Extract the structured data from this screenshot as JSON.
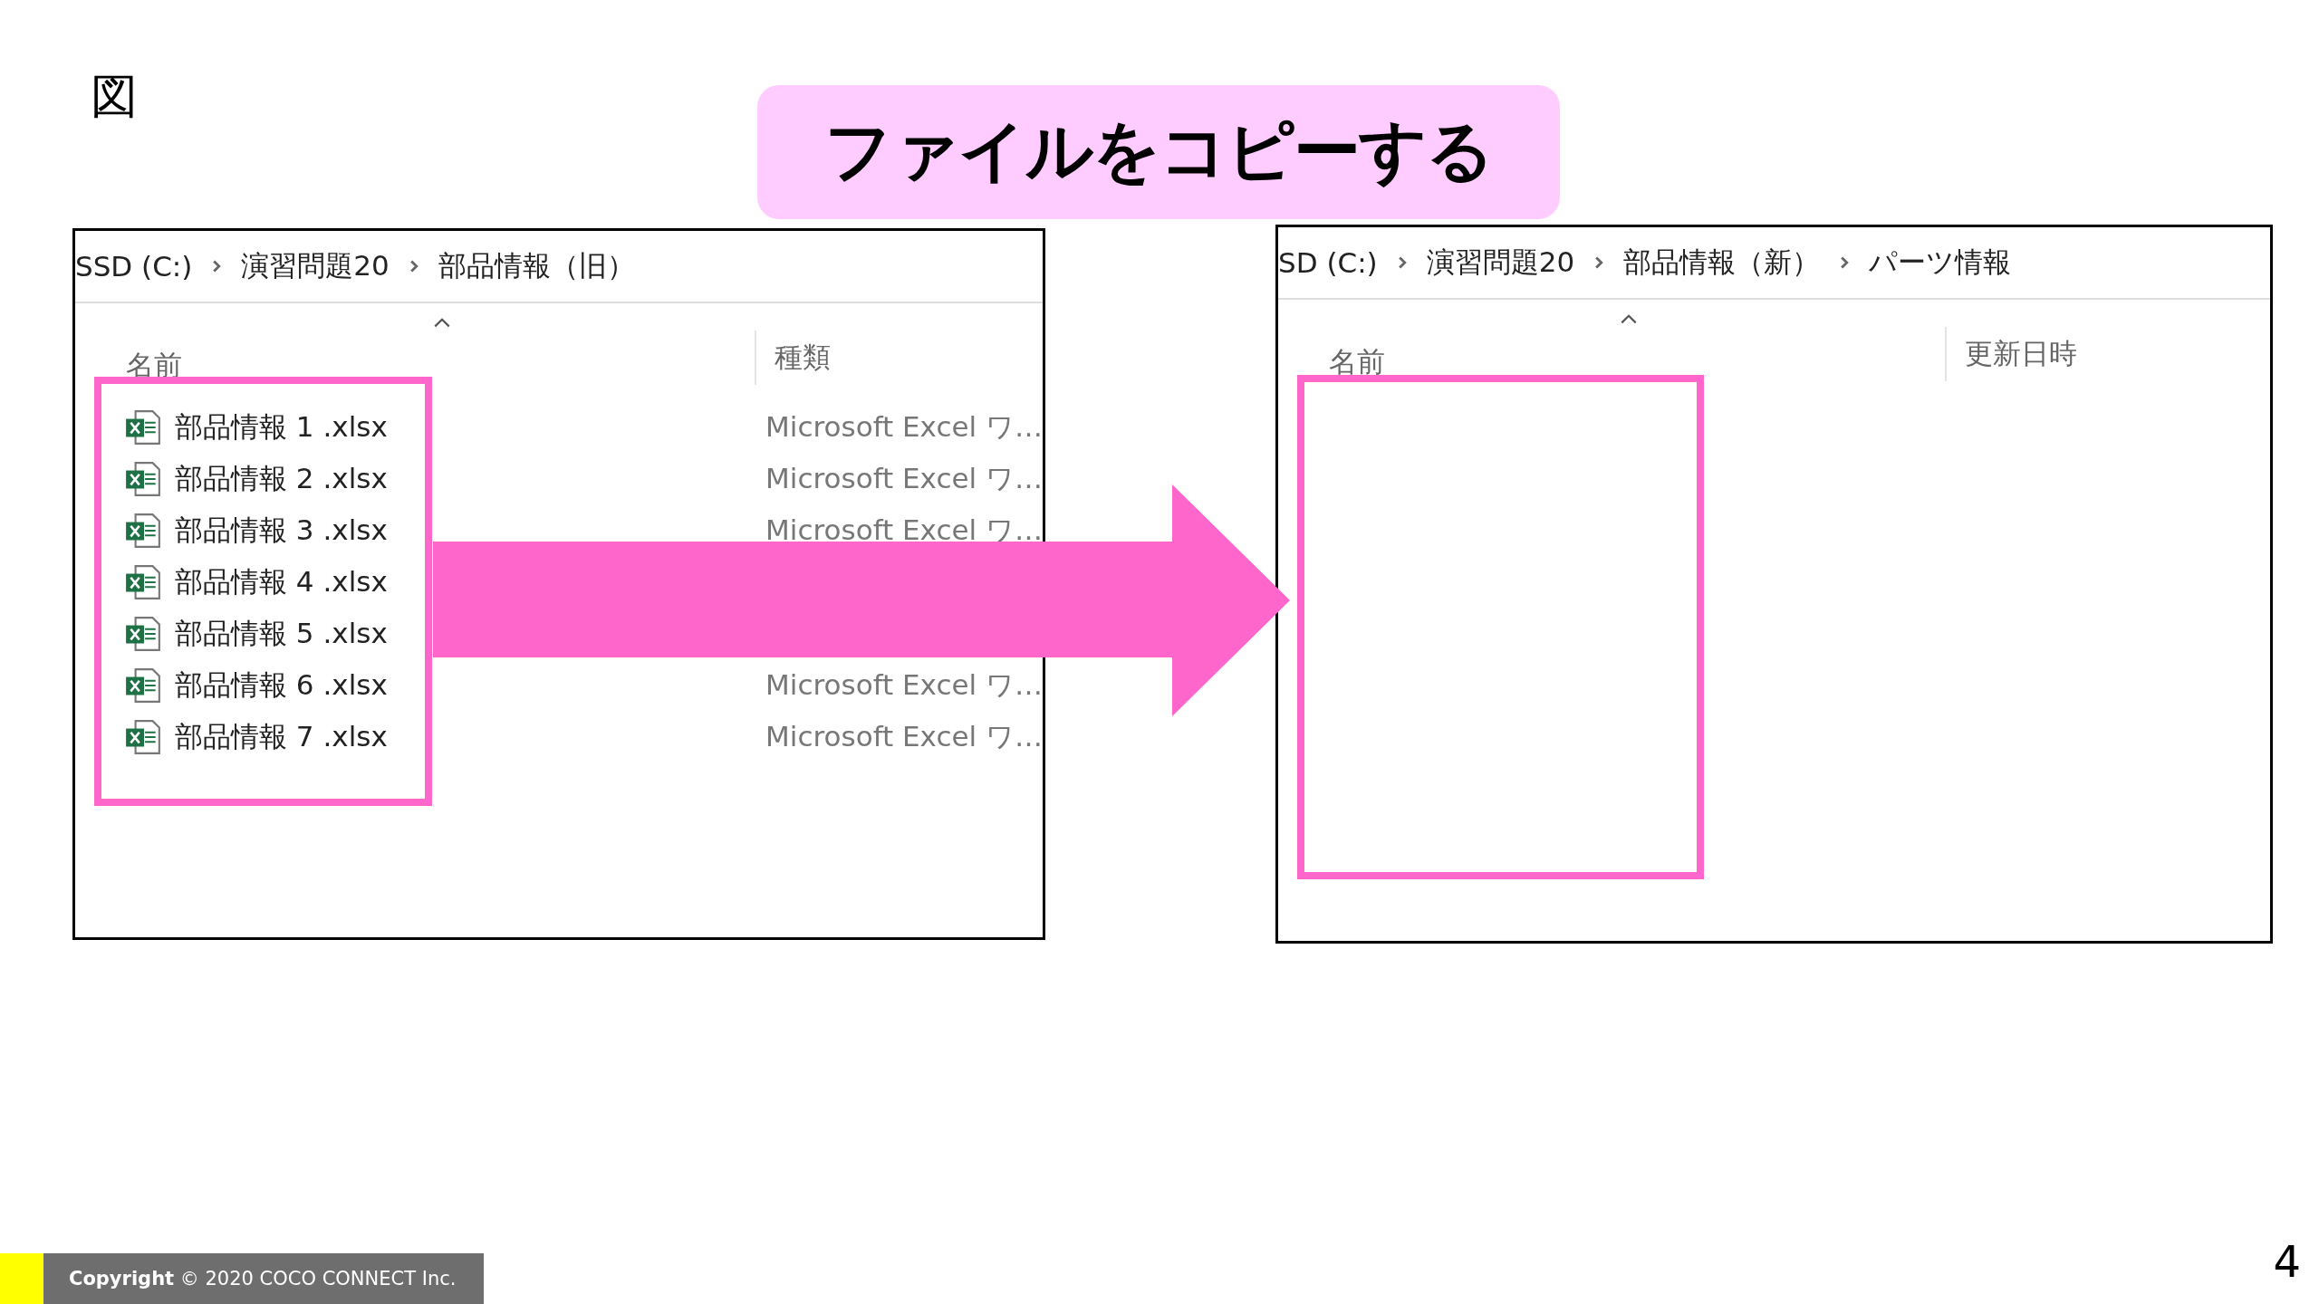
{
  "slide_label": "図",
  "title": "ファイルをコピーする",
  "windows": [
    {
      "breadcrumb": [
        "SSD (C:)",
        "演習問題20",
        "部品情報（旧）"
      ],
      "columns": [
        "名前",
        "種類"
      ],
      "files": [
        {
          "name": "部品情報 1 .xlsx",
          "type": "Microsoft Excel ワ…"
        },
        {
          "name": "部品情報 2 .xlsx",
          "type": "Microsoft Excel ワ…"
        },
        {
          "name": "部品情報 3 .xlsx",
          "type": "Microsoft Excel ワ…"
        },
        {
          "name": "部品情報 4 .xlsx"
        },
        {
          "name": "部品情報 5 .xlsx"
        },
        {
          "name": "部品情報 6 .xlsx",
          "type": "Microsoft Excel ワ…"
        },
        {
          "name": "部品情報 7 .xlsx",
          "type": "Microsoft Excel ワ…"
        }
      ]
    },
    {
      "breadcrumb": [
        "SD (C:)",
        "演習問題20",
        "部品情報（新）",
        "パーツ情報"
      ],
      "columns": [
        "名前",
        "更新日時"
      ]
    }
  ],
  "footer": {
    "copyright": "**Copyright** © 2020 COCO CONNECT Inc."
  },
  "page_number": "4"
}
